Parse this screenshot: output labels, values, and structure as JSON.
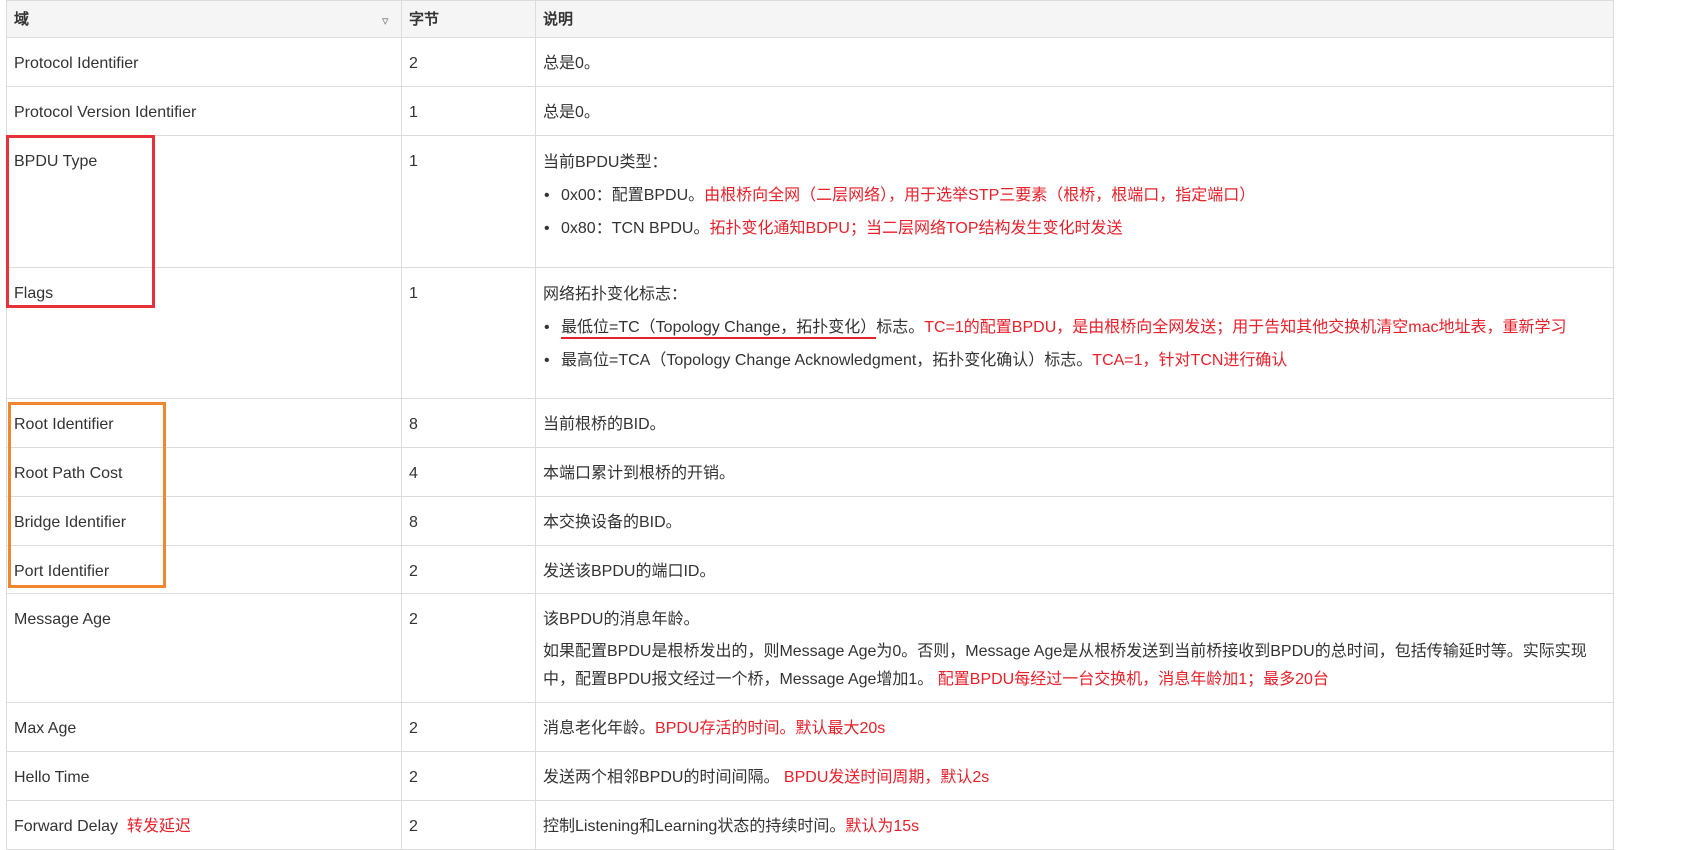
{
  "header": {
    "col_field": "域",
    "col_bytes": "字节",
    "col_desc": "说明",
    "filter_icon": "filter-icon"
  },
  "rows": [
    {
      "field": "Protocol Identifier",
      "bytes": "2",
      "desc": "总是0。"
    },
    {
      "field": "Protocol Version Identifier",
      "bytes": "1",
      "desc": "总是0。"
    },
    {
      "field": "BPDU Type",
      "bytes": "1",
      "desc": "当前BPDU类型：",
      "items": [
        {
          "text": "0x00：配置BPDU。",
          "note": "由根桥向全网（二层网络），用于选举STP三要素（根桥，根端口，指定端口）"
        },
        {
          "text": "0x80：TCN BPDU。",
          "note": "拓扑变化通知BDPU；当二层网络TOP结构发生变化时发送"
        }
      ]
    },
    {
      "field": "Flags",
      "bytes": "1",
      "desc": "网络拓扑变化标志：",
      "items": [
        {
          "underlined": "最低位=TC（Topology Change，拓扑变化）",
          "text": "标志。",
          "note": "TC=1的配置BPDU，是由根桥向全网发送；用于告知其他交换机清空mac地址表，重新学习"
        },
        {
          "text": "最高位=TCA（Topology Change Acknowledgment，拓扑变化确认）标志。",
          "note": "TCA=1，针对TCN进行确认"
        }
      ]
    },
    {
      "field": "Root Identifier",
      "bytes": "8",
      "desc": "当前根桥的BID。"
    },
    {
      "field": "Root Path Cost",
      "bytes": "4",
      "desc": "本端口累计到根桥的开销。"
    },
    {
      "field": "Bridge Identifier",
      "bytes": "8",
      "desc": "本交换设备的BID。"
    },
    {
      "field": "Port Identifier",
      "bytes": "2",
      "desc": "发送该BPDU的端口ID。"
    },
    {
      "field": "Message Age",
      "bytes": "2",
      "desc": "该BPDU的消息年龄。",
      "desc2": "如果配置BPDU是根桥发出的，则Message Age为0。否则，Message Age是从根桥发送到当前桥接收到BPDU的总时间，包括传输延时等。实际实现中，配置BPDU报文经过一个桥，Message Age增加1。",
      "note": "配置BPDU每经过一台交换机，消息年龄加1；最多20台"
    },
    {
      "field": "Max Age",
      "bytes": "2",
      "desc": "消息老化年龄。",
      "note": "BPDU存活的时间。默认最大20s"
    },
    {
      "field": "Hello Time",
      "bytes": "2",
      "desc": "发送两个相邻BPDU的时间间隔。",
      "note": "BPDU发送时间周期，默认2s"
    },
    {
      "field": "Forward Delay",
      "field_note": "转发延迟",
      "bytes": "2",
      "desc": "控制Listening和Learning状态的持续时间。",
      "note": "默认为15s"
    }
  ],
  "colors": {
    "annotation": "#e8202a",
    "box_red": "#e8303a",
    "box_orange": "#f0862e"
  }
}
